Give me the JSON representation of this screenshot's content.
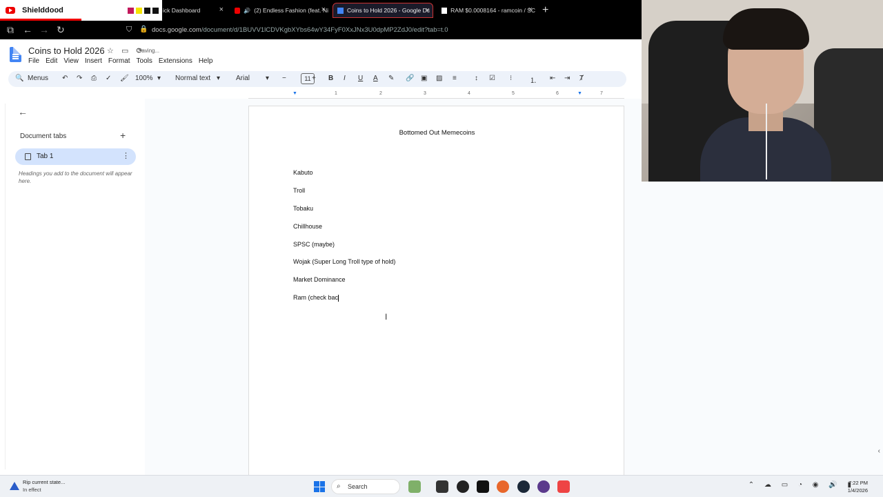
{
  "browser": {
    "yt_title": "Shielddood",
    "tabs": [
      {
        "label": "ick Dashboard"
      },
      {
        "label": "(2) Endless Fashion (feat. Ni"
      },
      {
        "label": "Coins to Hold 2026 - Google Dc"
      },
      {
        "label": "RAM $0.0008164 - ramcoin / SC"
      }
    ],
    "new_tab": "+",
    "url_host": "docs.google.com",
    "url_path": "/document/d/1BUVV1lCDVKgbXYbs64wY34FyF0XxJNx3U0dpMP2ZdJ0/edit?tab=t.0"
  },
  "docs": {
    "title": "Coins to Hold 2026",
    "status": "Saving...",
    "menu": [
      "File",
      "Edit",
      "View",
      "Insert",
      "Format",
      "Tools",
      "Extensions",
      "Help"
    ],
    "toolbar": {
      "menus_label": "Menus",
      "zoom": "100%",
      "style": "Normal text",
      "font": "Arial",
      "font_size": "11"
    },
    "ruler_marks": [
      "1",
      "1",
      "2",
      "3",
      "4",
      "5",
      "6",
      "7"
    ]
  },
  "sidebar": {
    "section_title": "Document tabs",
    "tab_label": "Tab 1",
    "hint": "Headings you add to the document will appear here."
  },
  "document": {
    "heading": "Bottomed Out Memecoins",
    "lines": [
      "Kabuto",
      "Troll",
      "Tobaku",
      "Chillhouse",
      "SPSC (maybe)",
      "Wojak (Super Long Troll type of hold)",
      "Market Dominance",
      "Ram (check bac"
    ]
  },
  "taskbar": {
    "notice_title": "Rip current state...",
    "notice_sub": "In effect",
    "search_label": "Search",
    "time": "7:22 PM",
    "date": "1/4/2026"
  },
  "colors": {
    "docs_blue": "#4285f4",
    "tab_active_bg": "#d3e3fd",
    "toolbar_bg": "#edf2fa",
    "youtube_red": "#ee0000"
  }
}
